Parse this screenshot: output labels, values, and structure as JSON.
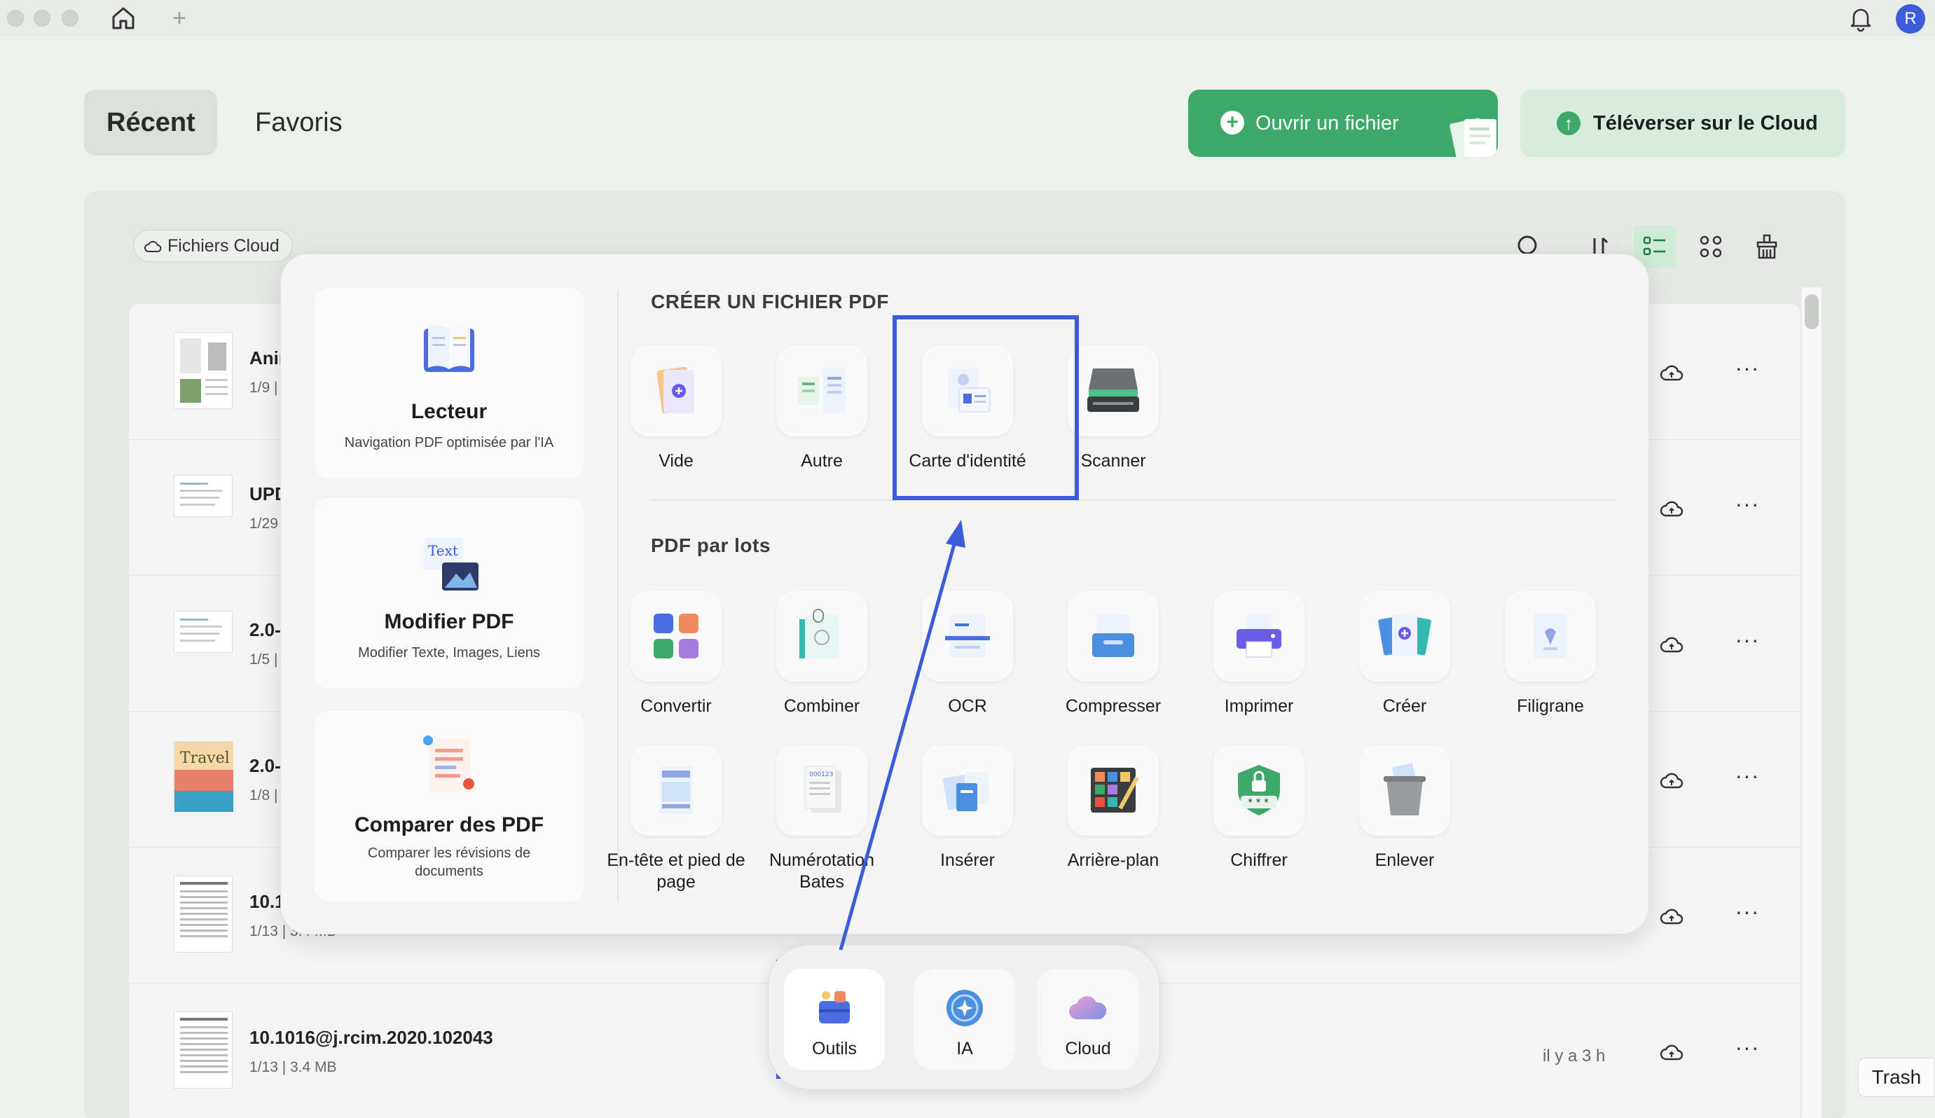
{
  "window": {
    "tabs_add": "+",
    "avatar_initial": "R"
  },
  "header": {
    "tab_recent": "Récent",
    "tab_favorites": "Favoris",
    "open_file": "Ouvrir un fichier",
    "upload_cloud": "Téléverser sur le Cloud"
  },
  "toolbar": {
    "cloud_files": "Fichiers Cloud"
  },
  "files": [
    {
      "name": "Anir",
      "meta": "1/9  |",
      "time": ""
    },
    {
      "name": "UPD",
      "meta": "1/29",
      "time": ""
    },
    {
      "name": "2.0-",
      "meta": "1/5  |",
      "time": ""
    },
    {
      "name": "2.0-",
      "meta": "1/8  |",
      "time": ""
    },
    {
      "name": "10.1",
      "meta": "1/13  |  3.4 MB",
      "time": ""
    },
    {
      "name": "10.1016@j.rcim.2020.102043",
      "meta": "1/13  |  3.4 MB",
      "time": "il y a 3 h"
    }
  ],
  "popup": {
    "features": [
      {
        "title": "Lecteur",
        "sub": "Navigation PDF optimisée par l'IA"
      },
      {
        "title": "Modifier PDF",
        "sub": "Modifier Texte, Images, Liens"
      },
      {
        "title": "Comparer des PDF",
        "sub": "Comparer les révisions de documents"
      }
    ],
    "create_title": "CRÉER UN FICHIER PDF",
    "create_tools": [
      "Vide",
      "Autre",
      "Carte d'identité",
      "Scanner"
    ],
    "batch_title": "PDF par lots",
    "batch_tools_row1": [
      "Convertir",
      "Combiner",
      "OCR",
      "Compresser",
      "Imprimer",
      "Créer",
      "Filigrane"
    ],
    "batch_tools_row2": [
      "En-tête et pied de page",
      "Numérotation Bates",
      "Insérer",
      "Arrière-plan",
      "Chiffrer",
      "Enlever"
    ],
    "icon_text": "Text"
  },
  "dock": {
    "items": [
      "Outils",
      "IA",
      "Cloud"
    ]
  },
  "trash": "Trash",
  "colors": {
    "accent_green": "#3ea869",
    "highlight_blue": "#3b5bdb"
  }
}
